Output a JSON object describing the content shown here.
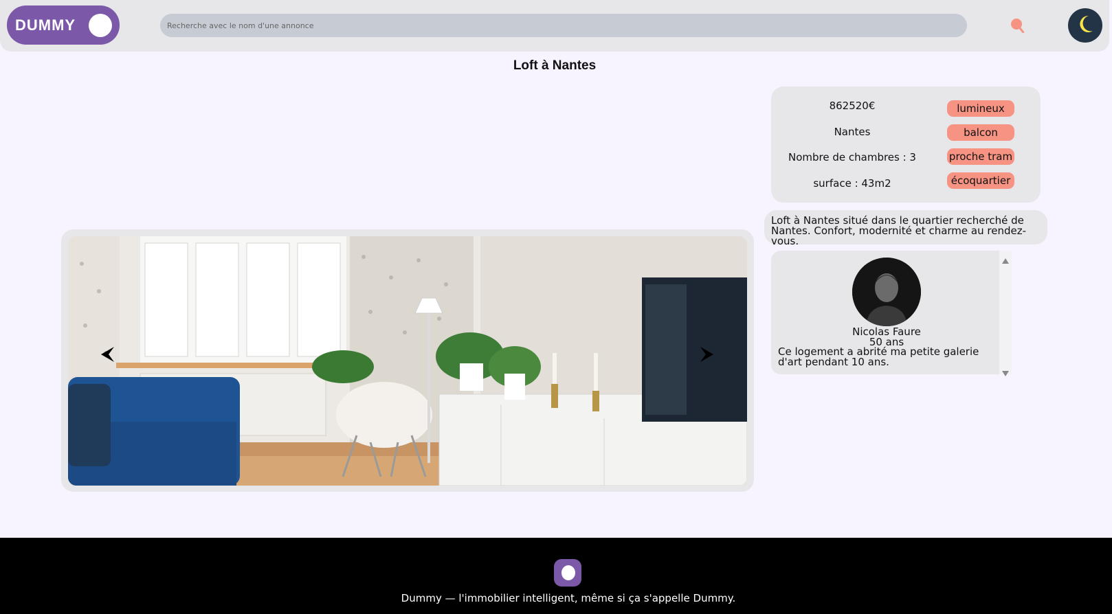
{
  "header": {
    "logo_text": "DUMMY",
    "search_placeholder": "Recherche avec le nom d'une annonce",
    "icons": {
      "search": "search-icon",
      "theme": "moon-icon"
    }
  },
  "listing": {
    "title": "Loft à Nantes",
    "price": "862520€",
    "city": "Nantes",
    "bedrooms": "Nombre de chambres : 3",
    "surface": "surface : 43m2",
    "tags": [
      "lumineux",
      "balcon",
      "proche tram",
      "écoquartier"
    ],
    "description": "Loft à Nantes situé dans le quartier recherché de Nantes. Confort, modernité et charme au rendez-vous."
  },
  "gallery": {
    "prev_icon": "chevron-left-icon",
    "next_icon": "chevron-right-icon"
  },
  "testimonial": {
    "name": "Nicolas Faure",
    "age": "50 ans",
    "quote": "Ce logement a abrité ma petite galerie d'art pendant 10 ans."
  },
  "footer": {
    "tagline": "Dummy — l'immobilier intelligent, même si ça s'appelle Dummy."
  },
  "colors": {
    "brand": "#7c59a8",
    "tag": "#f69382",
    "search_icon": "#f69382",
    "theme_toggle": "#243447",
    "moon": "#f5e44a"
  }
}
